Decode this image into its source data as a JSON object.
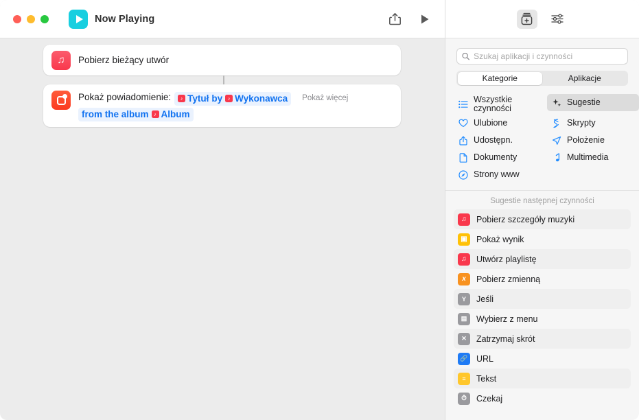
{
  "window": {
    "title": "Now Playing",
    "app_icon": "media-play-icon",
    "traffic_lights": [
      "close",
      "minimize",
      "zoom"
    ],
    "toolbar_right": [
      {
        "name": "share-icon",
        "label": "Udostępnij"
      },
      {
        "name": "play-icon",
        "label": "Uruchom"
      }
    ]
  },
  "workflow": {
    "actions": [
      {
        "icon": "music-note-icon",
        "icon_color": "#f9384c",
        "title": "Pobierz bieżący utwór"
      },
      {
        "icon": "notification-icon",
        "icon_color": "#fb3a20",
        "label": "Pokaż powiadomienie:",
        "tokens_line1": [
          {
            "type": "variable",
            "text": "Tytuł",
            "icon": "music-variable-icon"
          },
          {
            "type": "text",
            "text": "by"
          },
          {
            "type": "variable",
            "text": "Wykonawca",
            "icon": "music-variable-icon"
          }
        ],
        "tokens_line2": [
          {
            "type": "text",
            "text": "from the album"
          },
          {
            "type": "variable",
            "text": "Album",
            "icon": "music-variable-icon"
          }
        ],
        "show_more": "Pokaż więcej"
      }
    ]
  },
  "library": {
    "toolbar": [
      {
        "name": "action-library-icon",
        "label": "Biblioteka czynności",
        "selected": true
      },
      {
        "name": "sliders-icon",
        "label": "Ustawienia skrótu",
        "selected": false
      }
    ],
    "search": {
      "placeholder": "Szukaj aplikacji i czynności",
      "value": "",
      "icon": "search-icon"
    },
    "segments": [
      {
        "label": "Kategorie",
        "selected": true
      },
      {
        "label": "Aplikacje",
        "selected": false
      }
    ],
    "categories": [
      {
        "label": "Wszystkie czynności",
        "icon": "list-icon",
        "selected": false,
        "two_line": true
      },
      {
        "label": "Sugestie",
        "icon": "sparkles-icon",
        "selected": true,
        "two_line": false
      },
      {
        "label": "Ulubione",
        "icon": "heart-icon",
        "selected": false,
        "two_line": false
      },
      {
        "label": "Skrypty",
        "icon": "script-icon",
        "selected": false,
        "two_line": false
      },
      {
        "label": "Udostępn.",
        "icon": "share-icon",
        "selected": false,
        "two_line": false
      },
      {
        "label": "Położenie",
        "icon": "location-arrow-icon",
        "selected": false,
        "two_line": false
      },
      {
        "label": "Dokumenty",
        "icon": "document-icon",
        "selected": false,
        "two_line": false
      },
      {
        "label": "Multimedia",
        "icon": "music-note-icon",
        "selected": false,
        "two_line": false
      },
      {
        "label": "Strony www",
        "icon": "compass-icon",
        "selected": false,
        "two_line": false
      }
    ],
    "suggestions_header": "Sugestie następnej czynności",
    "suggestions": [
      {
        "label": "Pobierz szczegóły muzyki",
        "icon": "music-note-icon",
        "color": "#f9384c",
        "glyph": "♪"
      },
      {
        "label": "Pokaż wynik",
        "icon": "quick-look-icon",
        "color": "#ffc107",
        "glyph": "▣"
      },
      {
        "label": "Utwórz playlistę",
        "icon": "music-note-icon",
        "color": "#f9384c",
        "glyph": "♪"
      },
      {
        "label": "Pobierz zmienną",
        "icon": "variable-icon",
        "color": "#f89220",
        "glyph": "x"
      },
      {
        "label": "Jeśli",
        "icon": "branch-icon",
        "color": "#8e8e93",
        "glyph": "Y"
      },
      {
        "label": "Wybierz z menu",
        "icon": "menu-icon",
        "color": "#8e8e93",
        "glyph": "▤"
      },
      {
        "label": "Zatrzymaj skrót",
        "icon": "stop-icon",
        "color": "#8e8e93",
        "glyph": "✕"
      },
      {
        "label": "URL",
        "icon": "link-icon",
        "color": "#1f7bf5",
        "glyph": "🔗"
      },
      {
        "label": "Tekst",
        "icon": "text-icon",
        "color": "#ffc72c",
        "glyph": "≡"
      },
      {
        "label": "Czekaj",
        "icon": "clock-icon",
        "color": "#8e8e93",
        "glyph": "◴"
      }
    ]
  }
}
